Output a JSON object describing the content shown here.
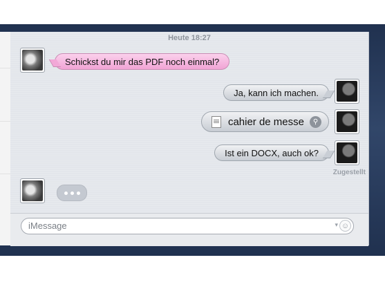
{
  "conversation": {
    "timestamp": "Heute 18:27",
    "messages": {
      "m1": {
        "text": "Schickst du mir das PDF noch einmal?"
      },
      "m2": {
        "text": "Ja, kann ich machen."
      },
      "m3": {
        "filename": "cahier de messe",
        "icon": "document-icon"
      },
      "m4": {
        "text": "Ist ein DOCX, auch ok?"
      }
    },
    "delivery_status": "Zugestellt",
    "typing_indicator": "..."
  },
  "input": {
    "placeholder": "iMessage",
    "emoji_icon": "smiley-icon"
  },
  "colors": {
    "incoming_bubble": "#f1a4d5",
    "outgoing_bubble": "#c7ccd3",
    "window_bg": "#e3e6eb",
    "desktop_bg": "#2a3d5f"
  }
}
